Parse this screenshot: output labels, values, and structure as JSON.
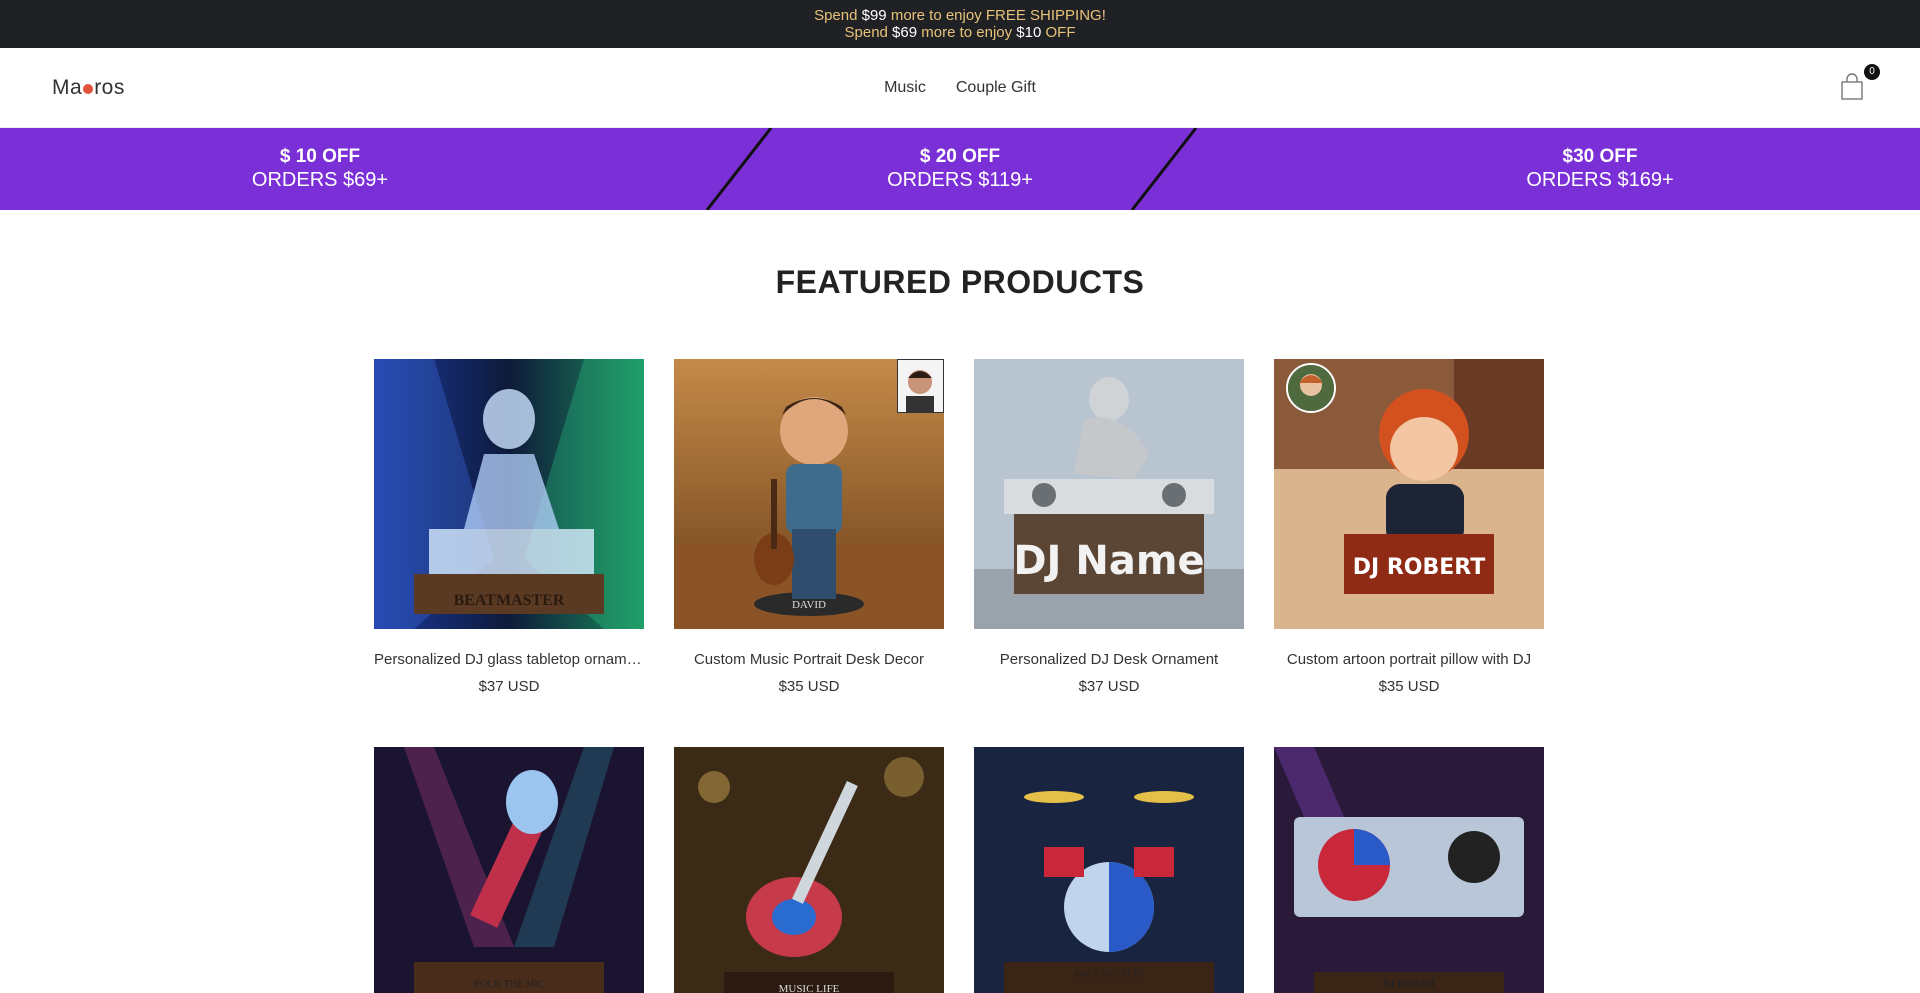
{
  "announcement": {
    "line1": {
      "pre": "Spend ",
      "amount": "$99",
      "post": " more to enjoy FREE SHIPPING!"
    },
    "line2": {
      "pre": "Spend ",
      "amount": "$69",
      "mid": " more to enjoy ",
      "amount2": "$10",
      "post": " OFF"
    }
  },
  "header": {
    "logo_text_a": "Ma",
    "logo_text_b": "ros",
    "nav": [
      {
        "label": "Music"
      },
      {
        "label": "Couple Gift"
      }
    ],
    "cart_count": "0"
  },
  "promo": [
    {
      "line1": "$ 10 OFF",
      "line2": "ORDERS $69+"
    },
    {
      "line1": "$ 20 OFF",
      "line2": "ORDERS $119+"
    },
    {
      "line1": "$30 OFF",
      "line2": "ORDERS $169+"
    }
  ],
  "featured": {
    "title": "FEATURED PRODUCTS",
    "products": [
      {
        "name": "Personalized DJ glass tabletop ornament",
        "price": "$37 USD",
        "plaque": "BEATMASTER"
      },
      {
        "name": "Custom Music Portrait Desk Decor",
        "price": "$35 USD",
        "plaque": "DAVID"
      },
      {
        "name": "Personalized DJ Desk Ornament",
        "price": "$37 USD",
        "plaque": "DJ Name"
      },
      {
        "name": "Custom artoon portrait pillow with DJ",
        "price": "$35 USD",
        "plaque": "DJ ROBERT"
      },
      {
        "name": "",
        "price": "",
        "plaque": "ROCK THE MIC"
      },
      {
        "name": "",
        "price": "",
        "plaque": "MUSIC LIFE"
      },
      {
        "name": "",
        "price": "",
        "plaque": "ROCK THE BEAT"
      },
      {
        "name": "",
        "price": "",
        "plaque": "DJ POWER"
      }
    ]
  },
  "colors": {
    "announce_bg": "#202124",
    "announce_text": "#e8c27a",
    "promo_bg": "#7b2fd6"
  },
  "icons": {
    "cart": "shopping-bag-icon"
  }
}
